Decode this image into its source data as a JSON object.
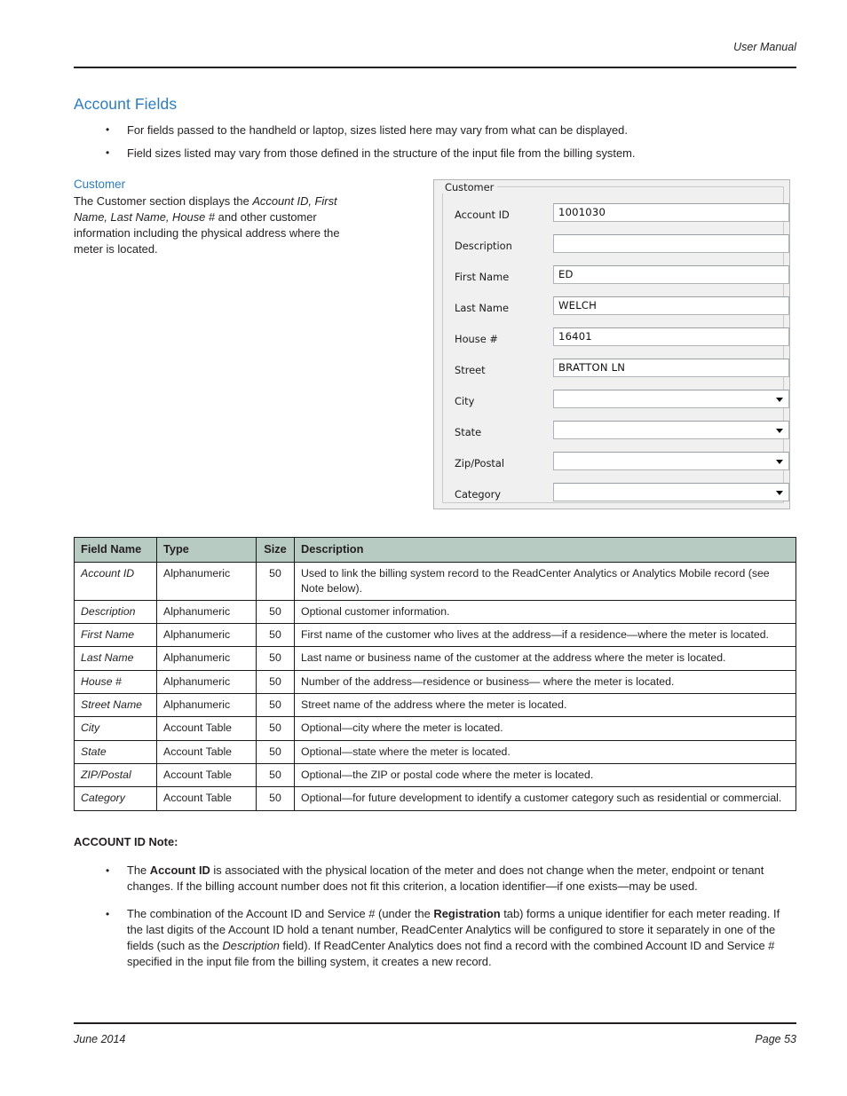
{
  "header": {
    "running_head": "User Manual"
  },
  "section": {
    "title": "Account Fields",
    "bullets": [
      "For fields passed to the handheld or laptop, sizes listed here may vary from what can be displayed.",
      "Field sizes listed may vary from those defined in the structure of the input file from the billing system."
    ]
  },
  "customer_block": {
    "heading": "Customer",
    "text_part1": "The Customer section displays the ",
    "italic1": "Account ID, First Name, Last Name, House #",
    "text_part2": " and other customer information including the physical address where the meter is located."
  },
  "screenshot": {
    "group_title": "Customer",
    "fields": [
      {
        "label": "Account ID",
        "value": "1001030",
        "control": "textbox"
      },
      {
        "label": "Description",
        "value": "",
        "control": "textbox"
      },
      {
        "label": "First Name",
        "value": "ED",
        "control": "textbox"
      },
      {
        "label": "Last Name",
        "value": "WELCH",
        "control": "textbox"
      },
      {
        "label": "House #",
        "value": "16401",
        "control": "textbox"
      },
      {
        "label": "Street",
        "value": "BRATTON LN",
        "control": "textbox"
      },
      {
        "label": "City",
        "value": "",
        "control": "combobox"
      },
      {
        "label": "State",
        "value": "",
        "control": "combobox"
      },
      {
        "label": "Zip/Postal",
        "value": "",
        "control": "combobox"
      },
      {
        "label": "Category",
        "value": "",
        "control": "combobox"
      }
    ]
  },
  "table": {
    "columns": [
      "Field Name",
      "Type",
      "Size",
      "Description"
    ],
    "rows": [
      {
        "field": "Account ID",
        "type": "Alphanumeric",
        "size": "50",
        "description": "Used to link the billing system record to the ReadCenter Analytics or Analytics Mobile record (see Note below)."
      },
      {
        "field": "Description",
        "type": "Alphanumeric",
        "size": "50",
        "description": "Optional customer information."
      },
      {
        "field": "First Name",
        "type": "Alphanumeric",
        "size": "50",
        "description": "First name of the customer who lives at the address—if a residence—where the meter is located."
      },
      {
        "field": "Last Name",
        "type": "Alphanumeric",
        "size": "50",
        "description": "Last name or business name of the customer at the address where the meter is located."
      },
      {
        "field": "House #",
        "type": "Alphanumeric",
        "size": "50",
        "description": "Number of the address—residence or business— where the meter is located."
      },
      {
        "field": "Street Name",
        "type": "Alphanumeric",
        "size": "50",
        "description": "Street name of the address where the meter is located."
      },
      {
        "field": "City",
        "type": "Account Table",
        "size": "50",
        "description": "Optional—city where the meter is located."
      },
      {
        "field": "State",
        "type": "Account Table",
        "size": "50",
        "description": "Optional—state where the meter is located."
      },
      {
        "field": "ZIP/Postal",
        "type": "Account Table",
        "size": "50",
        "description": "Optional—the ZIP or postal code where the meter is located."
      },
      {
        "field": "Category",
        "type": "Account Table",
        "size": "50",
        "description": "Optional—for future development to identify a customer category such as residential or commercial."
      }
    ]
  },
  "note": {
    "title": "ACCOUNT ID Note:",
    "bullet1": {
      "lead": "The ",
      "bold": "Account ID",
      "rest": " is associated with the physical location of the meter and does not change when the meter, endpoint or tenant changes. If the billing account number does not fit this criterion, a location identifier—if one exists—may be used."
    },
    "bullet2": {
      "p1": "The combination of the Account ID and Service # (under the ",
      "bold1": "Registration",
      "p2": " tab) forms a unique identifier for each meter reading. If the last digits of the Account ID hold a tenant number, ReadCenter Analytics will be configured to store it separately in one of the fields (such as the ",
      "italic1": "Description",
      "p3": " field). If ReadCenter Analytics does not find a record with the combined Account ID and Service # specified in the input file from the billing system, it creates a new record."
    }
  },
  "footer": {
    "left": "June 2014",
    "right": "Page 53"
  },
  "colors": {
    "heading_blue": "#2b7dc0",
    "table_header_bg": "#b8cbc3",
    "rule": "#231f20",
    "panel_bg": "#f0f0f0"
  }
}
